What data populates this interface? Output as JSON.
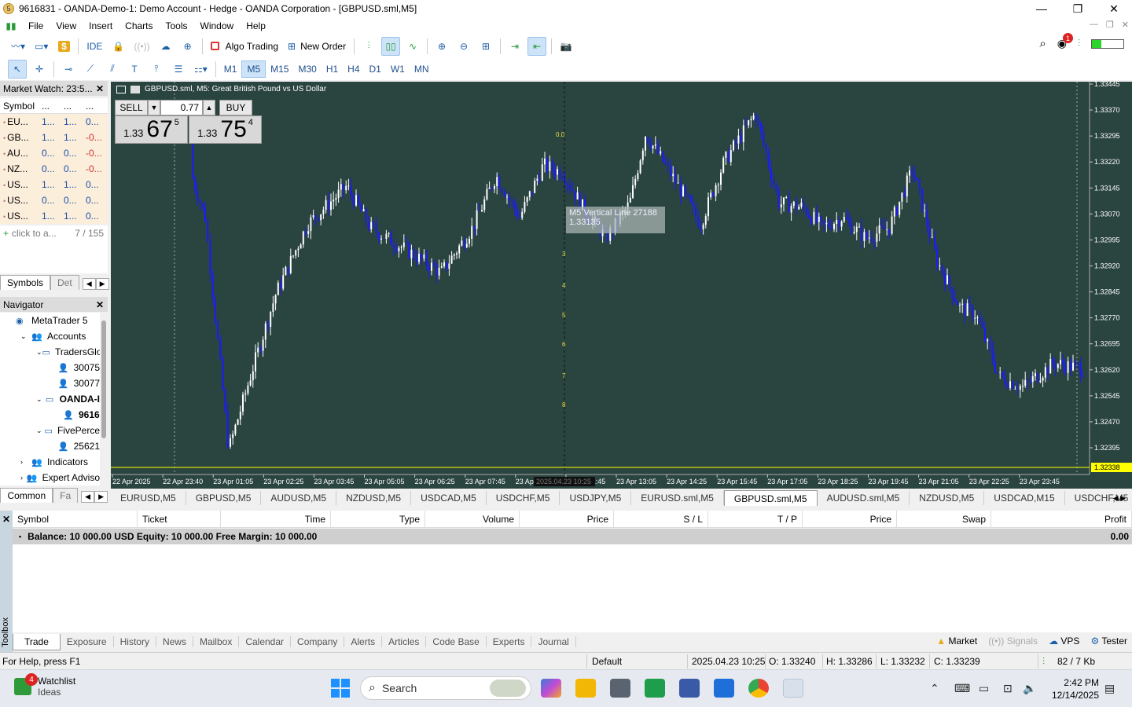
{
  "window": {
    "title": "9616831 - OANDA-Demo-1: Demo Account - Hedge - OANDA Corporation - [GBPUSD.sml,M5]",
    "controls": [
      "—",
      "❐",
      "✕"
    ]
  },
  "menu": [
    "File",
    "View",
    "Insert",
    "Charts",
    "Tools",
    "Window",
    "Help"
  ],
  "toolbar": {
    "ide": "IDE",
    "algo_trading": "Algo Trading",
    "new_order": "New Order",
    "notification_count": "1"
  },
  "timeframes": [
    "M1",
    "M5",
    "M15",
    "M30",
    "H1",
    "H4",
    "D1",
    "W1",
    "MN"
  ],
  "active_timeframe": "M5",
  "market_watch": {
    "title": "Market Watch: 23:5...",
    "columns": [
      "Symbol",
      "...",
      "...",
      "..."
    ],
    "rows": [
      {
        "symbol": "EU...",
        "bid": "1...",
        "ask": "1...",
        "chg": "0...",
        "neg": false
      },
      {
        "symbol": "GB...",
        "bid": "1...",
        "ask": "1...",
        "chg": "-0...",
        "neg": true
      },
      {
        "symbol": "AU...",
        "bid": "0...",
        "ask": "0...",
        "chg": "-0...",
        "neg": true
      },
      {
        "symbol": "NZ...",
        "bid": "0...",
        "ask": "0...",
        "chg": "-0...",
        "neg": true
      },
      {
        "symbol": "US...",
        "bid": "1...",
        "ask": "1...",
        "chg": "0...",
        "neg": false
      },
      {
        "symbol": "US...",
        "bid": "0...",
        "ask": "0...",
        "chg": "0...",
        "neg": false
      },
      {
        "symbol": "US...",
        "bid": "1...",
        "ask": "1...",
        "chg": "0...",
        "neg": false
      }
    ],
    "add_text": "click to a...",
    "count": "7 / 155",
    "tabs": [
      "Symbols",
      "Det"
    ]
  },
  "navigator": {
    "title": "Navigator",
    "items": [
      {
        "label": "MetaTrader 5",
        "indent": 0,
        "bold": false
      },
      {
        "label": "Accounts",
        "indent": 1,
        "bold": false
      },
      {
        "label": "TradersGlo",
        "indent": 2,
        "bold": false
      },
      {
        "label": "30075",
        "indent": 3,
        "bold": false
      },
      {
        "label": "30077",
        "indent": 3,
        "bold": false
      },
      {
        "label": "OANDA-I",
        "indent": 2,
        "bold": true
      },
      {
        "label": "9616",
        "indent": 3,
        "bold": true
      },
      {
        "label": "FivePerce",
        "indent": 2,
        "bold": false
      },
      {
        "label": "25621",
        "indent": 3,
        "bold": false
      },
      {
        "label": "Indicators",
        "indent": 1,
        "bold": false
      },
      {
        "label": "Expert Adviso",
        "indent": 1,
        "bold": false
      }
    ],
    "tabs": [
      "Common",
      "Fa"
    ]
  },
  "chart": {
    "header": "GBPUSD.sml, M5:  Great British Pound vs US Dollar",
    "one_click": {
      "sell": "SELL",
      "buy": "BUY",
      "volume": "0.77",
      "sell_price": {
        "prefix": "1.33",
        "big": "67",
        "sup": "5"
      },
      "buy_price": {
        "prefix": "1.33",
        "big": "75",
        "sup": "4"
      }
    },
    "vline_label": "M5 Vertical Line 27188",
    "vline_price": "1.33135",
    "price_ticks": [
      "1.33445",
      "1.33370",
      "1.33295",
      "1.33220",
      "1.33145",
      "1.33070",
      "1.32995",
      "1.32920",
      "1.32845",
      "1.32770",
      "1.32695",
      "1.32620",
      "1.32545",
      "1.32470",
      "1.32395"
    ],
    "current_price": "1.32338",
    "time_ticks": [
      "22 Apr 2025",
      "22 Apr 23:40",
      "23 Apr 01:05",
      "23 Apr 02:25",
      "23 Apr 03:45",
      "23 Apr 05:05",
      "23 Apr 06:25",
      "23 Apr 07:45",
      "23 Apr",
      "23 Apr 11:45",
      "23 Apr 13:05",
      "23 Apr 14:25",
      "23 Apr 15:45",
      "23 Apr 17:05",
      "23 Apr 18:25",
      "23 Apr 19:45",
      "23 Apr 21:05",
      "23 Apr 22:25",
      "23 Apr 23:45"
    ],
    "cursor_time": "2025.04.23 10:25",
    "fib_labels": [
      "0.0",
      "3",
      "4",
      "5",
      "6",
      "7",
      "8"
    ],
    "colors": {
      "background": "#2a4440",
      "bull": "#ffffff",
      "bear": "#1a1aff",
      "axis_text": "#ffffff",
      "price_line": "#ffff00"
    }
  },
  "chart_tabs": [
    "EURUSD,M5",
    "GBPUSD,M5",
    "AUDUSD,M5",
    "NZDUSD,M5",
    "USDCAD,M5",
    "USDCHF,M5",
    "USDJPY,M5",
    "EURUSD.sml,M5",
    "GBPUSD.sml,M5",
    "AUDUSD.sml,M5",
    "NZDUSD,M5",
    "USDCAD,M15",
    "USDCHF,M5",
    "US"
  ],
  "active_chart_tab": "GBPUSD.sml,M5",
  "toolbox": {
    "label": "Toolbox",
    "columns": [
      "Symbol",
      "Ticket",
      "Time",
      "Type",
      "Volume",
      "Price",
      "S / L",
      "T / P",
      "Price",
      "Swap",
      "Profit"
    ],
    "balance_row": "Balance: 10 000.00 USD  Equity: 10 000.00  Free Margin: 10 000.00",
    "profit": "0.00",
    "tabs": [
      "Trade",
      "Exposure",
      "History",
      "News",
      "Mailbox",
      "Calendar",
      "Company",
      "Alerts",
      "Articles",
      "Code Base",
      "Experts",
      "Journal"
    ],
    "active_tab": "Trade",
    "right_tabs": {
      "market": "Market",
      "signals": "Signals",
      "vps": "VPS",
      "tester": "Tester"
    }
  },
  "status": {
    "help": "For Help, press F1",
    "profile": "Default",
    "datetime": "2025.04.23 10:25",
    "open": "O: 1.33240",
    "high": "H: 1.33286",
    "low": "L: 1.33232",
    "close": "C: 1.33239",
    "traffic": "82 / 7 Kb"
  },
  "taskbar": {
    "widget_title": "Watchlist",
    "widget_sub": "Ideas",
    "widget_badge": "4",
    "search": "Search",
    "time": "2:42 PM",
    "date": "12/14/2025"
  }
}
